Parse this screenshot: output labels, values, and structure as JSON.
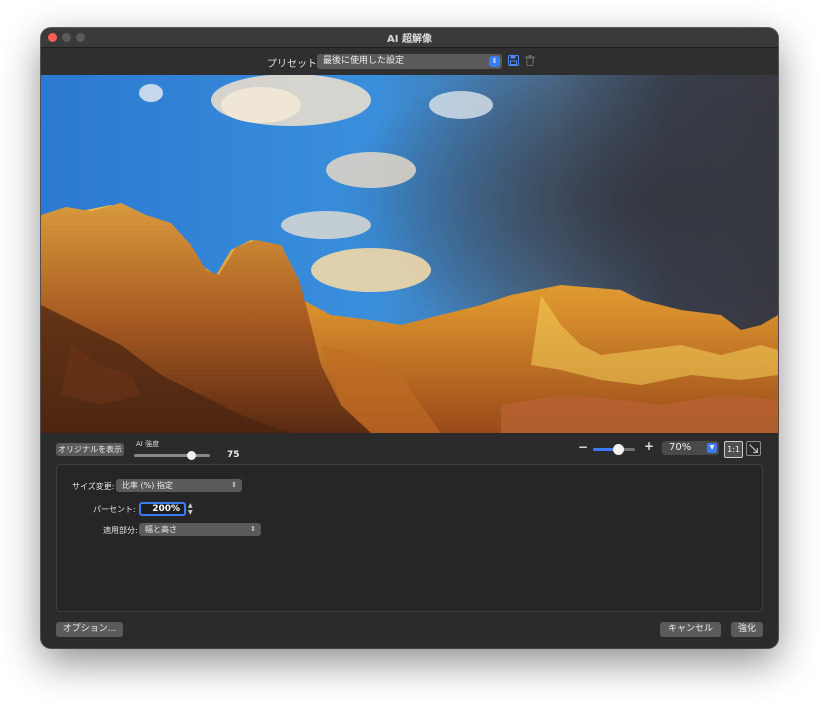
{
  "window": {
    "title": "AI 超解像"
  },
  "preset": {
    "label": "プリセット",
    "selected": "最後に使用した設定"
  },
  "controls": {
    "show_original": "オリジナルを表示",
    "ai_strength_label": "AI 強度",
    "ai_strength_value": "75",
    "ai_strength_level": 0.75,
    "zoom_minus": "−",
    "zoom_plus": "+",
    "zoom_value": "70%",
    "zoom_level": 0.6,
    "actual_size": "1:1"
  },
  "settings": {
    "resize_label": "サイズ変更:",
    "resize_value": "比率 (%) 指定",
    "percent_label": "パーセント:",
    "percent_value": "200%",
    "apply_label": "適用部分:",
    "apply_value": "幅と高さ"
  },
  "footer": {
    "options": "オプション...",
    "cancel": "キャンセル",
    "enhance": "強化"
  },
  "colors": {
    "accent": "#3d7bf5",
    "window_bg": "#2b2b2b",
    "close": "#ff5f57"
  }
}
